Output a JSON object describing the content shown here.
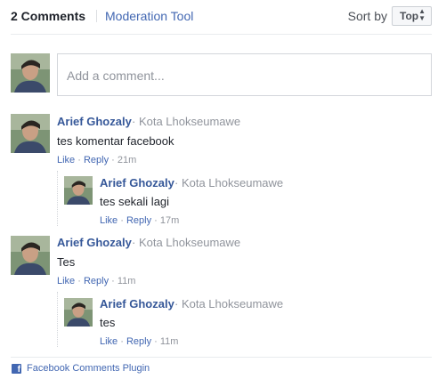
{
  "header": {
    "comment_count": "2 Comments",
    "moderation_tool": "Moderation Tool",
    "sort_by_label": "Sort by",
    "sort_value": "Top"
  },
  "compose": {
    "placeholder": "Add a comment..."
  },
  "comments": [
    {
      "author": "Arief Ghozaly",
      "location": "· Kota Lhokseumawe",
      "text": "tes komentar facebook",
      "like": "Like",
      "reply": "Reply",
      "time": "21m",
      "replies": [
        {
          "author": "Arief Ghozaly",
          "location": "· Kota Lhokseumawe",
          "text": "tes sekali lagi",
          "like": "Like",
          "reply": "Reply",
          "time": "17m"
        }
      ]
    },
    {
      "author": "Arief Ghozaly",
      "location": "· Kota Lhokseumawe",
      "text": "Tes",
      "like": "Like",
      "reply": "Reply",
      "time": "11m",
      "replies": [
        {
          "author": "Arief Ghozaly",
          "location": "· Kota Lhokseumawe",
          "text": "tes",
          "like": "Like",
          "reply": "Reply",
          "time": "11m"
        }
      ]
    }
  ],
  "footer": {
    "plugin_label": "Facebook Comments Plugin",
    "logo_letter": "f"
  },
  "colors": {
    "link": "#4267b2",
    "author": "#365899",
    "muted": "#90949c"
  }
}
